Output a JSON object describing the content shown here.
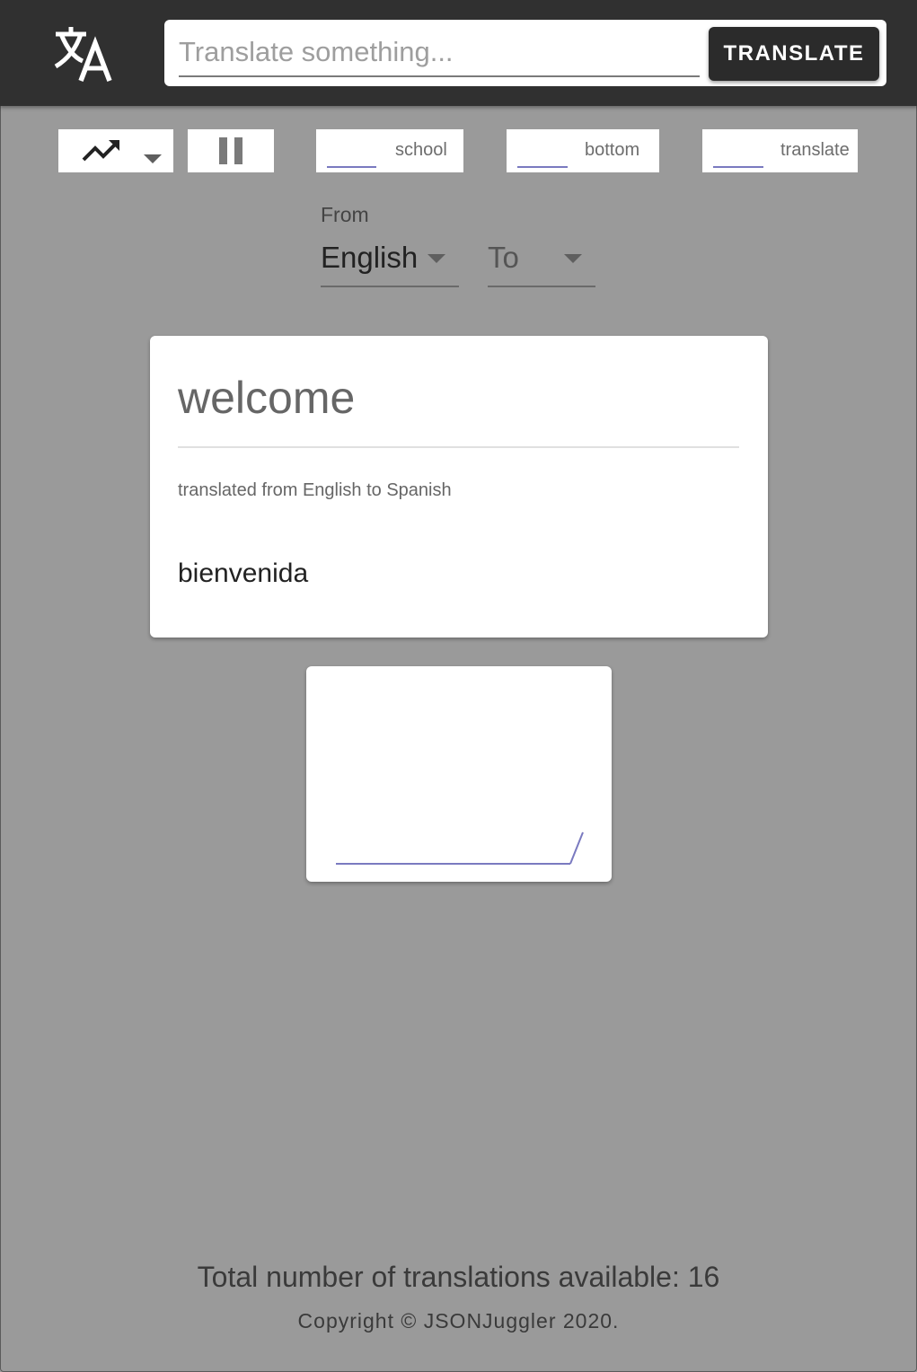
{
  "header": {
    "logo_icon": "translate-icon",
    "search": {
      "placeholder": "Translate something...",
      "value": ""
    },
    "translate_button": "TRANSLATE"
  },
  "toolbar": {
    "trend_icon": "trending-up-icon",
    "pause_icon": "pause-icon",
    "fields": [
      {
        "label": "school"
      },
      {
        "label": "bottom"
      },
      {
        "label": "translate"
      }
    ]
  },
  "languages": {
    "from_label": "From",
    "from_value": "English",
    "to_value": "To"
  },
  "result": {
    "word": "welcome",
    "meta": "translated from English to Spanish",
    "translation": "bienvenida"
  },
  "footer": {
    "total": "Total number of translations available: 16",
    "copyright": "Copyright © JSONJuggler 2020."
  },
  "colors": {
    "header_bg": "#303030",
    "page_bg": "#9a9a9a",
    "accent_line": "#7a7ac0"
  }
}
